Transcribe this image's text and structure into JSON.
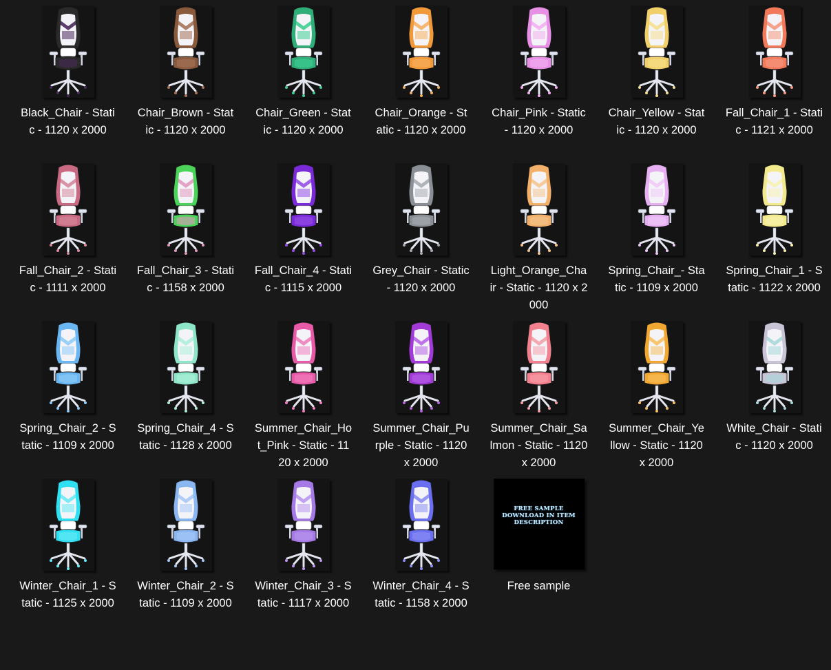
{
  "files": [
    {
      "name": "Black_Chair - Static - 1120 x 2000",
      "color": "#2a2a2a",
      "accent": "#4a2a5a"
    },
    {
      "name": "Chair_Brown - Static - 1120 x 2000",
      "color": "#8a5a3c",
      "accent": "#a7735a"
    },
    {
      "name": "Chair_Green - Static - 1120 x 2000",
      "color": "#2fae7a",
      "accent": "#3fcf95"
    },
    {
      "name": "Chair_Orange - Static - 1120 x 2000",
      "color": "#f29a3a",
      "accent": "#f7b060"
    },
    {
      "name": "Chair_Pink - Static - 1120 x 2000",
      "color": "#e890e6",
      "accent": "#f3b0f0"
    },
    {
      "name": "Chair_Yellow - Static - 1120 x 2000",
      "color": "#f1cf6a",
      "accent": "#f6df8e"
    },
    {
      "name": "Fall_Chair_1 - Static - 1121 x 2000",
      "color": "#f27a5a",
      "accent": "#f59a80"
    },
    {
      "name": "Fall_Chair_2 - Static - 1111 x 2000",
      "color": "#c96a82",
      "accent": "#d68a9d"
    },
    {
      "name": "Fall_Chair_3 - Static - 1158 x 2000",
      "color": "#4cd35a",
      "accent": "#e29ac0"
    },
    {
      "name": "Fall_Chair_4 - Static - 1115 x 2000",
      "color": "#7a2ad8",
      "accent": "#9650e6"
    },
    {
      "name": "Grey_Chair - Static - 1120 x 2000",
      "color": "#8a8f96",
      "accent": "#a8adb4"
    },
    {
      "name": "Light_Orange_Chair - Static - 1120 x 2000",
      "color": "#f2b06a",
      "accent": "#f5c690"
    },
    {
      "name": "Spring_Chair_- Static - 1109 x 2000",
      "color": "#e6b0f2",
      "accent": "#f0caf7"
    },
    {
      "name": "Spring_Chair_1 - Static - 1122 x 2000",
      "color": "#f3ea8e",
      "accent": "#f7f1b2"
    },
    {
      "name": "Spring_Chair_2 - Static - 1109 x 2000",
      "color": "#6ab6f2",
      "accent": "#90cbf7"
    },
    {
      "name": "Spring_Chair_4 - Static - 1128 x 2000",
      "color": "#8ee6c8",
      "accent": "#aef0da"
    },
    {
      "name": "Summer_Chair_Hot_Pink - Static - 1120 x 2000",
      "color": "#e85aa8",
      "accent": "#f080bd"
    },
    {
      "name": "Summer_Chair_Purple - Static - 1120 x 2000",
      "color": "#a23ad8",
      "accent": "#b865e6"
    },
    {
      "name": "Summer_Chair_Salmon - Static - 1120 x 2000",
      "color": "#f2808e",
      "accent": "#f6a0aa"
    },
    {
      "name": "Summer_Chair_Yellow - Static - 1120 x 2000",
      "color": "#f2a830",
      "accent": "#f6c060"
    },
    {
      "name": "White_Chair - Static - 1120 x 2000",
      "color": "#c9c3d6",
      "accent": "#a8d8d8"
    },
    {
      "name": "Winter_Chair_1 - Static - 1125 x 2000",
      "color": "#2ee0f2",
      "accent": "#6aeaf6"
    },
    {
      "name": "Winter_Chair_2 - Static - 1109 x 2000",
      "color": "#8ab6f2",
      "accent": "#a8c9f6"
    },
    {
      "name": "Winter_Chair_3 - Static - 1117 x 2000",
      "color": "#a67ae6",
      "accent": "#bb98ee"
    },
    {
      "name": "Winter_Chair_4 - Static - 1158 x 2000",
      "color": "#6a6ef0",
      "accent": "#8c8ff4"
    }
  ],
  "sample": {
    "name": "Free sample",
    "thumb_line1": "FREE SAMPLE",
    "thumb_line2": "DOWNLOAD IN ITEM",
    "thumb_line3": "DESCRIPTION",
    "text_color": "#bfe9ff"
  },
  "colors": {
    "background": "#191919",
    "text": "#ffffff"
  }
}
